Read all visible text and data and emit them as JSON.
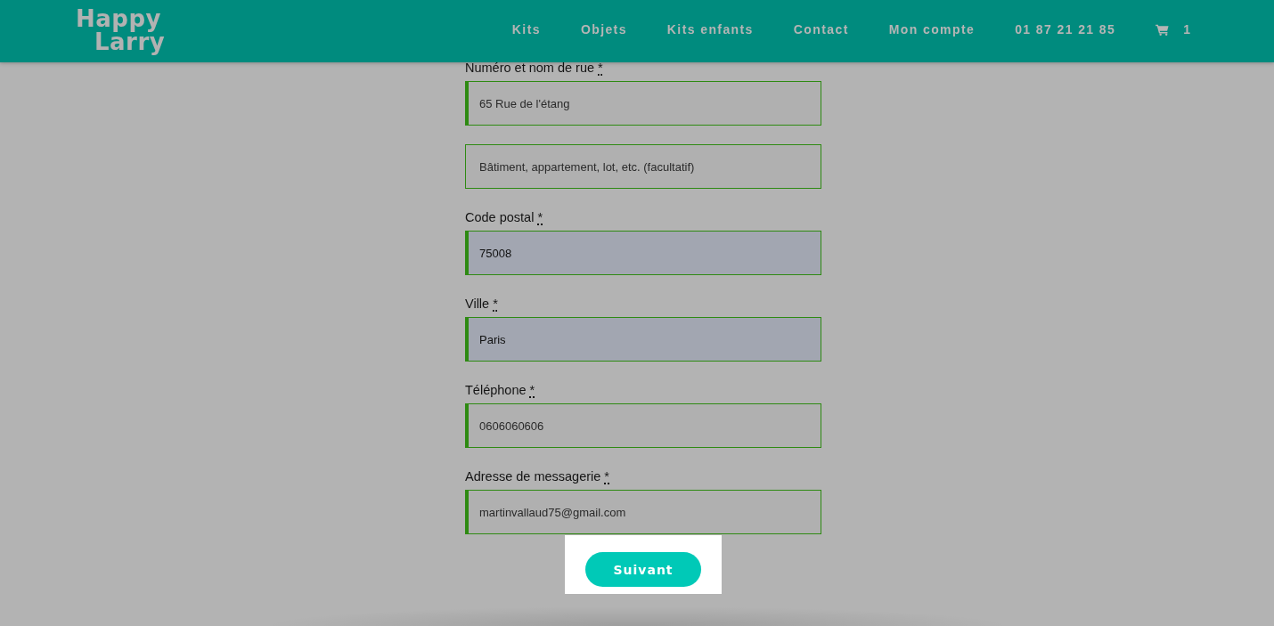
{
  "header": {
    "logo": [
      "Happy",
      "Larry"
    ],
    "nav": [
      "Kits",
      "Objets",
      "Kits enfants",
      "Contact",
      "Mon compte",
      "01 87 21 21 85"
    ],
    "cart": {
      "count": "1"
    }
  },
  "form": {
    "fields": [
      {
        "label": "Numéro et nom de rue",
        "required_mark": "*",
        "value": "65 Rue de l'étang",
        "validated": true,
        "autofilled": false
      },
      {
        "placeholder": "Bâtiment, appartement, lot, etc. (facultatif)",
        "validated": false,
        "autofilled": false
      },
      {
        "label": "Code postal",
        "required_mark": "*",
        "value": "75008",
        "validated": true,
        "autofilled": true
      },
      {
        "label": "Ville",
        "required_mark": "*",
        "value": "Paris",
        "validated": true,
        "autofilled": true
      },
      {
        "label": "Téléphone",
        "required_mark": "*",
        "value": "0606060606",
        "validated": true,
        "autofilled": false
      },
      {
        "label": "Adresse de messagerie",
        "required_mark": "*",
        "value": "martinvallaud75@gmail.com",
        "validated": true,
        "autofilled": false
      }
    ],
    "submit": {
      "label": "Suivant"
    }
  }
}
